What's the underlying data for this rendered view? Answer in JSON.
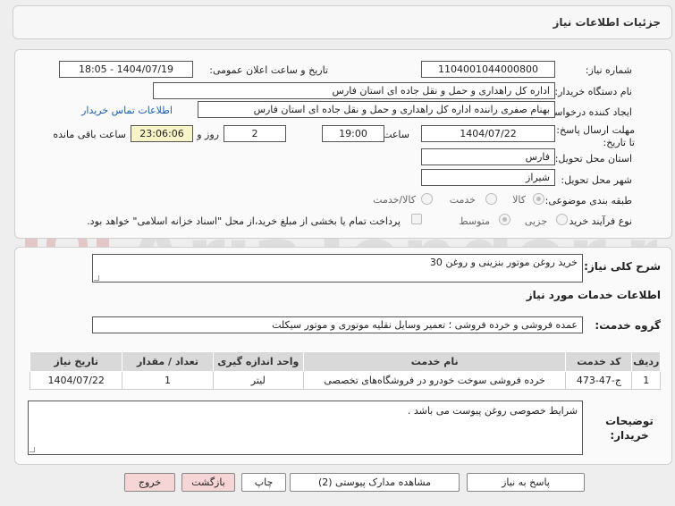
{
  "header": {
    "title": "جزئیات اطلاعات نیاز"
  },
  "watermark": {
    "text": "AriaTender.net"
  },
  "form": {
    "need_number_label": "شماره نیاز:",
    "need_number": "1104001044000800",
    "announce_label": "تاریخ و ساعت اعلان عمومی:",
    "announce_value": "1404/07/19 - 18:05",
    "buyer_org_label": "نام دستگاه خریدار:",
    "buyer_org": "اداره کل راهداری و حمل و نقل جاده ای استان فارس",
    "creator_label": "ایجاد کننده درخواست:",
    "creator": "بهنام صفری راننده اداره کل راهداری و حمل و نقل جاده ای استان فارس",
    "contact_link": "اطلاعات تماس خریدار",
    "deadline_label": "مهلت ارسال پاسخ: تا تاریخ:",
    "deadline_date": "1404/07/22",
    "time_label": "ساعت",
    "deadline_time": "19:00",
    "days_value": "2",
    "days_label": "روز و",
    "remaining_time": "23:06:06",
    "remaining_label": "ساعت باقی مانده",
    "province_label": "استان محل تحویل:",
    "province": "فارس",
    "city_label": "شهر محل تحویل:",
    "city": "شیراز",
    "category_label": "طبقه بندی موضوعی:",
    "category_options": [
      "کالا",
      "خدمت",
      "کالا/خدمت"
    ],
    "purchase_type_label": "نوع فرآیند خرید :",
    "purchase_options": [
      "جزیی",
      "متوسط"
    ],
    "payment_note": "پرداخت تمام یا بخشی از مبلغ خرید،از محل \"اسناد خزانه اسلامی\" خواهد بود."
  },
  "summary": {
    "label": "شرح کلی نیاز:",
    "value": "خرید روغن موتور بنزینی و روغن 30"
  },
  "services": {
    "section_title": "اطلاعات خدمات مورد نیاز",
    "group_label": "گروه خدمت:",
    "group_value": "عمده فروشی و خرده فروشی ؛ تعمیر وسایل نقلیه موتوری و موتور سیکلت",
    "columns": [
      "ردیف",
      "کد خدمت",
      "نام خدمت",
      "واحد اندازه گیری",
      "تعداد / مقدار",
      "تاریخ نیاز"
    ],
    "rows": [
      [
        "1",
        "ج-47-473",
        "خرده فروشی سوخت خودرو در فروشگاه‌های تخصصی",
        "لیتر",
        "1",
        "1404/07/22"
      ]
    ]
  },
  "notes": {
    "label": "توضیحات خریدار:",
    "value": "شرایط خصوصی روغن پیوست می باشد ."
  },
  "buttons": {
    "reply": "پاسخ به نیاز",
    "view_docs": "مشاهده مدارک پیوستی (2)",
    "print": "چاپ",
    "back": "بازگشت",
    "exit": "خروج"
  }
}
